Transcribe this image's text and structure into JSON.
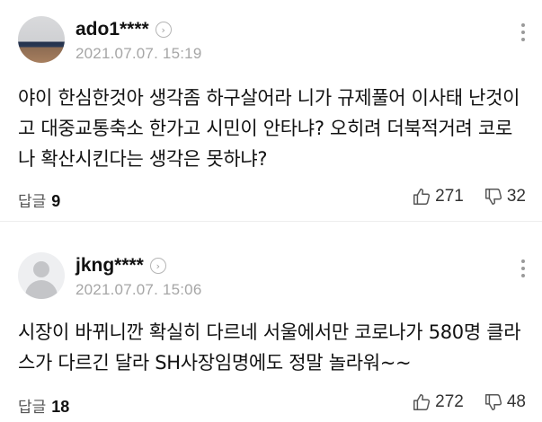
{
  "comments": [
    {
      "username": "ado1****",
      "timestamp": "2021.07.07. 15:19",
      "text": "야이 한심한것아 생각좀 하구살어라 니가 규제풀어 이사태 난것이고 대중교통축소 한가고 시민이 안타냐? 오히려 더북적거려 코로나 확산시킨다는 생각은 못하냐?",
      "reply_label": "답글",
      "reply_count": "9",
      "likes": "271",
      "dislikes": "32",
      "avatar": "user-photo"
    },
    {
      "username": "jkng****",
      "timestamp": "2021.07.07. 15:06",
      "text": "시장이 바뀌니깐 확실히 다르네 서울에서만 코로나가 580명 클라스가 다르긴 달라 SH사장임명에도 정말 놀라워~~",
      "reply_label": "답글",
      "reply_count": "18",
      "likes": "272",
      "dislikes": "48",
      "avatar": "default-profile"
    }
  ],
  "icons": {
    "profile_arrow": "chevron-right-circle-icon",
    "more": "more-vertical-icon",
    "like": "thumbs-up-icon",
    "dislike": "thumbs-down-icon"
  }
}
